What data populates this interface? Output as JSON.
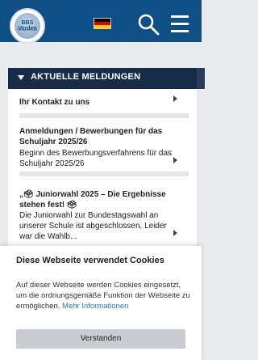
{
  "header": {
    "logo_text": "BBS Verden",
    "logo_subtext": "Europaschule",
    "flag_label": "Deutsch"
  },
  "news": {
    "title": "AKTUELLE MELDUNGEN",
    "items": [
      {
        "title": "Ihr Kontakt zu uns",
        "description": ""
      },
      {
        "title": "Anmeldungen / Bewerbungen für das Schuljahr 2025/26",
        "description": "Beginn des Bewerbungsverfahrens für das Schuljahr 2025/26"
      },
      {
        "title": "„🗳 Juniorwahl 2025 – Die Ergebnisse stehen fest! 🗳",
        "description": "Die Juniorwahl zur Bundestagswahl an unserer Schule ist abgeschlossen. Leider war die Wahlb..."
      }
    ]
  },
  "cookie": {
    "title": "Diese Webseite verwendet Cookies",
    "body": "Auf dieser Webseite werden Cookies eingesetzt, um die ordnungsgemäße Funktion der Webseite zu ermöglichen.",
    "link": "Mehr Informationen",
    "button": "Verstanden"
  },
  "colors": {
    "header_bg": "#0f4f86",
    "card_head_bg": "#172c47",
    "link": "#2b73b7"
  }
}
